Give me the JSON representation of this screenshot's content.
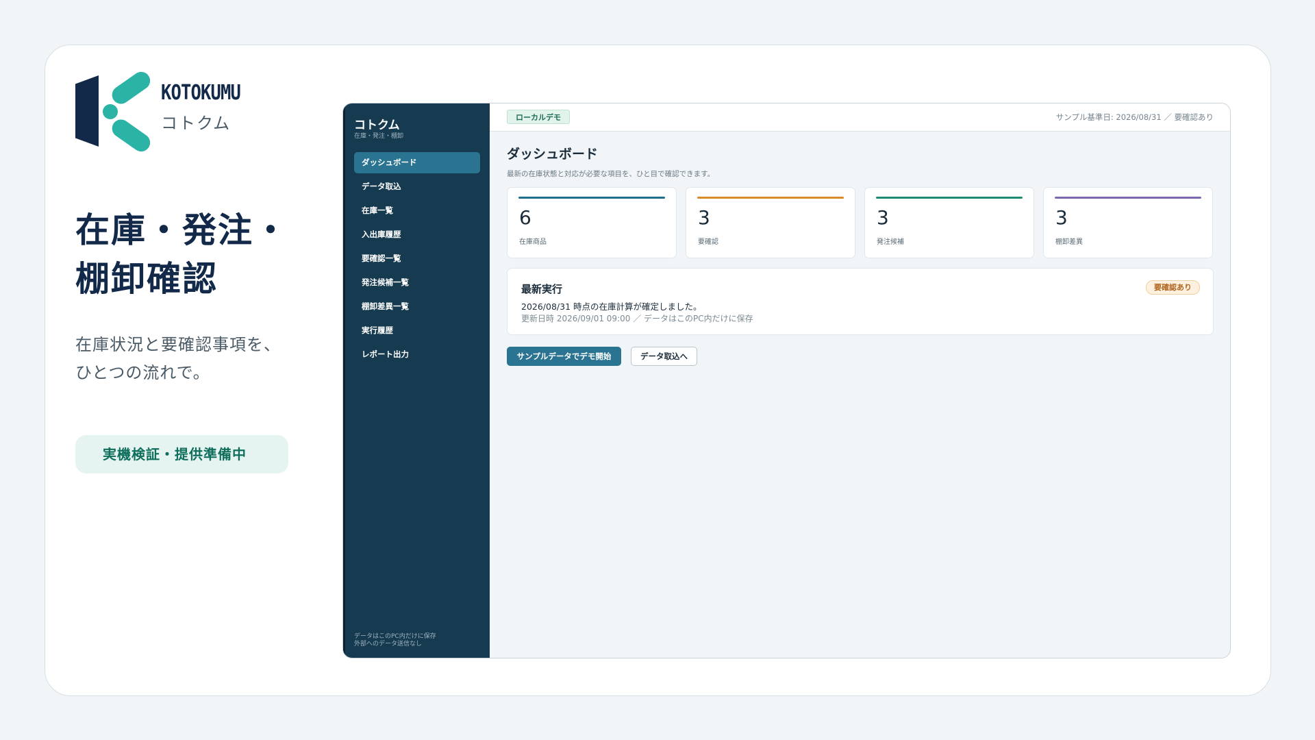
{
  "brand": {
    "name_en": "KOTOKUMU",
    "name_jp": "コトクム",
    "logo_icon": "kotokumu-k-logo-icon",
    "colors": {
      "navy": "#13294a",
      "teal": "#2bb3a6"
    }
  },
  "hero": {
    "line1": "在庫・発注・",
    "line2": "棚卸確認",
    "sub1": "在庫状況と要確認事項を、",
    "sub2": "ひとつの流れで。",
    "status": "実機検証・提供準備中"
  },
  "app": {
    "sidebar": {
      "title": "コトクム",
      "subtitle": "在庫・発注・棚卸",
      "items": [
        {
          "label": "ダッシュボード",
          "active": true
        },
        {
          "label": "データ取込"
        },
        {
          "label": "在庫一覧"
        },
        {
          "label": "入出庫履歴"
        },
        {
          "label": "要確認一覧"
        },
        {
          "label": "発注候補一覧"
        },
        {
          "label": "棚卸差異一覧"
        },
        {
          "label": "実行履歴"
        },
        {
          "label": "レポート出力"
        }
      ],
      "footer1": "データはこのPC内だけに保存",
      "footer2": "外部へのデータ送信なし"
    },
    "topbar": {
      "badge": "ローカルデモ",
      "meta": "サンプル基準日: 2026/08/31 ／ 要確認あり"
    },
    "dashboard": {
      "title": "ダッシュボード",
      "description": "最新の在庫状態と対応が必要な項目を、ひと目で確認できます。",
      "kpis": [
        {
          "value": "6",
          "label": "在庫商品",
          "color": "#1e6f8c"
        },
        {
          "value": "3",
          "label": "要確認",
          "color": "#d98a2b"
        },
        {
          "value": "3",
          "label": "発注候補",
          "color": "#1e8a74"
        },
        {
          "value": "3",
          "label": "棚卸差異",
          "color": "#7b68b0"
        }
      ],
      "latest": {
        "title": "最新実行",
        "badge": "要確認あり",
        "message": "2026/08/31 時点の在庫計算が確定しました。",
        "meta": "更新日時 2026/09/01 09:00 ／ データはこのPC内だけに保存"
      },
      "primary_button": "サンプルデータでデモ開始",
      "secondary_button": "データ取込へ"
    }
  }
}
